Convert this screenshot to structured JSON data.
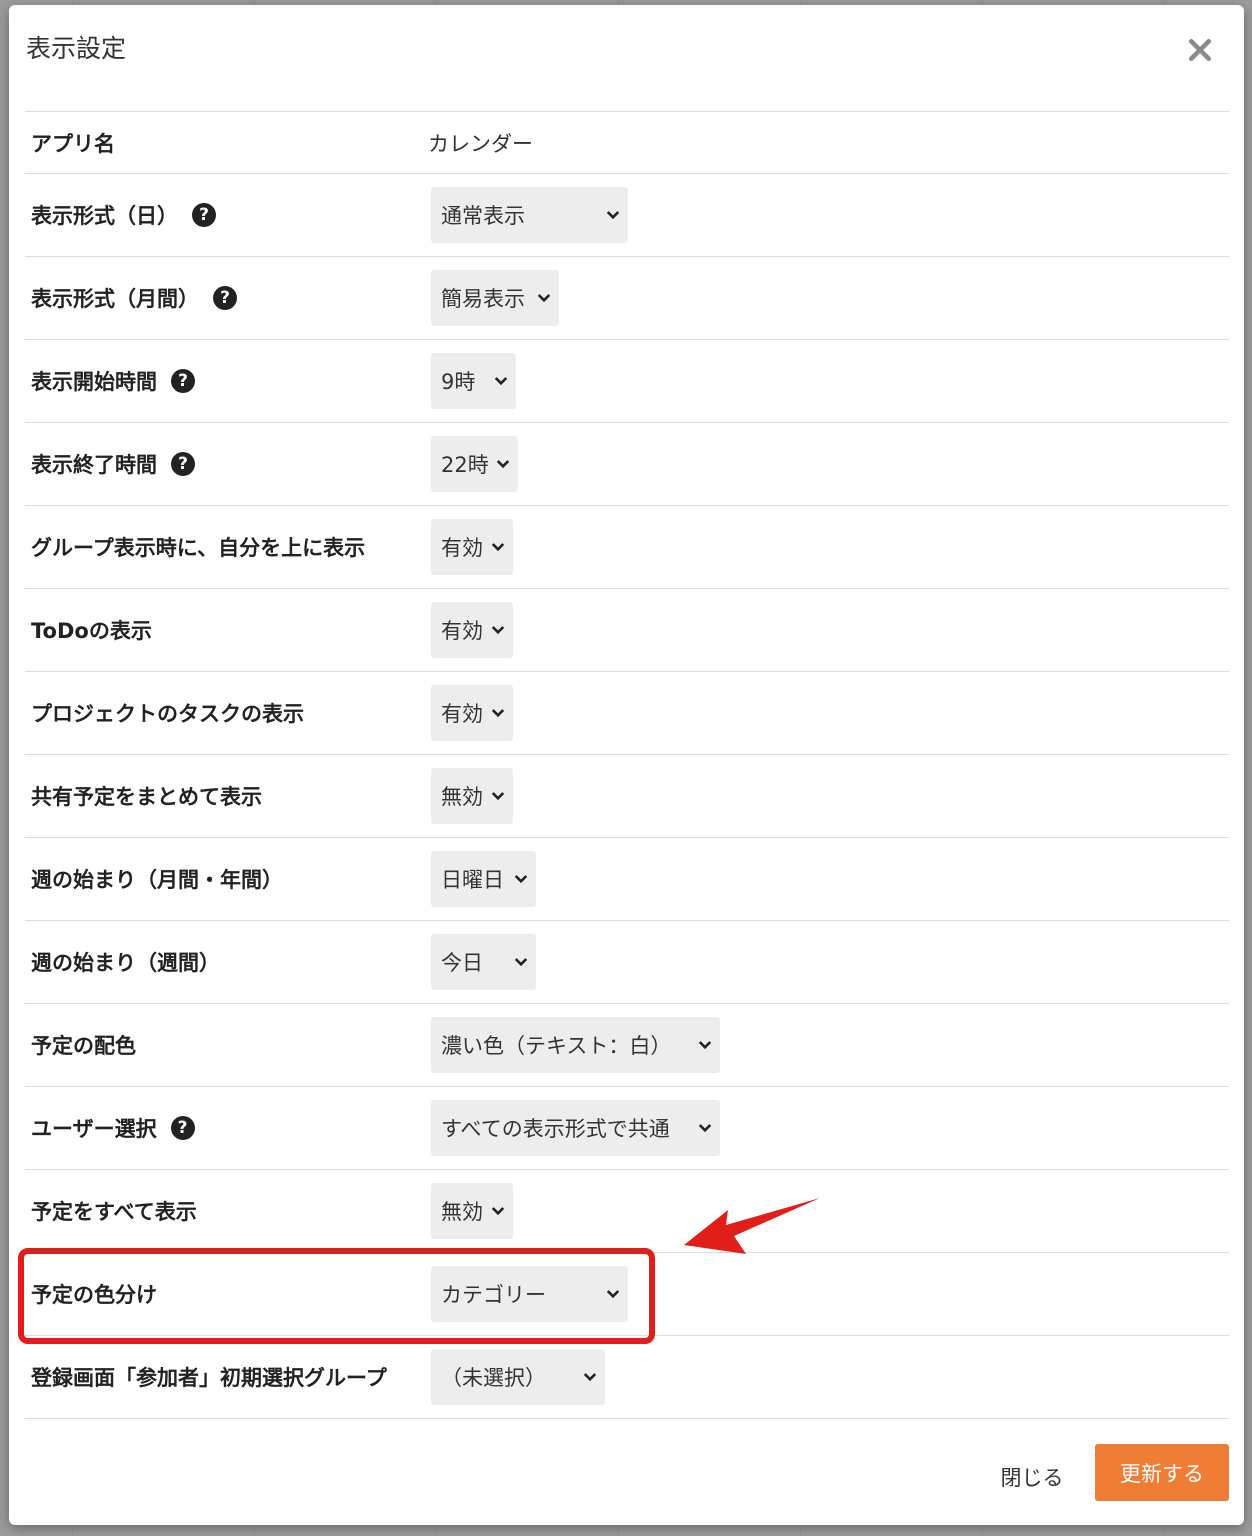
{
  "modal": {
    "title": "表示設定",
    "close_icon": "close-icon"
  },
  "rows": [
    {
      "label": "アプリ名",
      "value": "カレンダー"
    },
    {
      "label": "表示形式（日）",
      "help": true,
      "value": "通常表示"
    },
    {
      "label": "表示形式（月間）",
      "help": true,
      "value": "簡易表示"
    },
    {
      "label": "表示開始時間",
      "help": true,
      "value": "9時"
    },
    {
      "label": "表示終了時間",
      "help": true,
      "value": "22時"
    },
    {
      "label": "グループ表示時に、自分を上に表示",
      "value": "有効"
    },
    {
      "label": "ToDoの表示",
      "value": "有効"
    },
    {
      "label": "プロジェクトのタスクの表示",
      "value": "有効"
    },
    {
      "label": "共有予定をまとめて表示",
      "value": "無効"
    },
    {
      "label": "週の始まり（月間・年間）",
      "value": "日曜日"
    },
    {
      "label": "週の始まり（週間）",
      "value": "今日"
    },
    {
      "label": "予定の配色",
      "value": "濃い色（テキスト：白）"
    },
    {
      "label": "ユーザー選択",
      "help": true,
      "value": "すべての表示形式で共通"
    },
    {
      "label": "予定をすべて表示",
      "value": "無効"
    },
    {
      "label": "予定の色分け",
      "value": "カテゴリー"
    },
    {
      "label": "登録画面「参加者」初期選択グループ",
      "value": "（未選択）"
    }
  ],
  "help_icon_glyph": "?",
  "footer": {
    "close_label": "閉じる",
    "update_label": "更新する"
  },
  "colors": {
    "accent": "#ef7d33",
    "highlight": "#e01e1a"
  }
}
